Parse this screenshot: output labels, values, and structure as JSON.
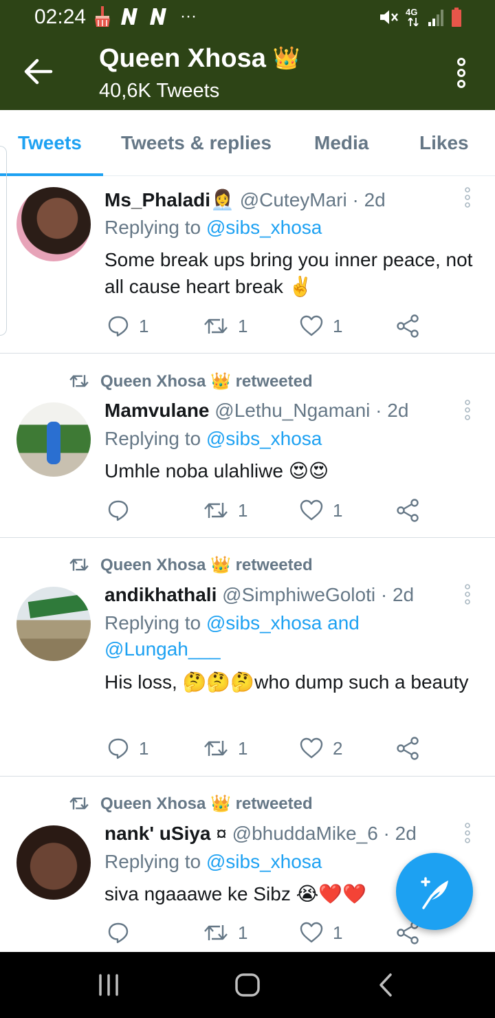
{
  "status_bar": {
    "time": "02:24",
    "left_icons": [
      "broom-icon",
      "n-icon",
      "n-icon",
      "more-dots-icon"
    ],
    "dots": "···",
    "network": "4G",
    "right_icons": [
      "mute-icon",
      "network-4g-icon",
      "signal-icon",
      "battery-icon"
    ]
  },
  "header": {
    "title": "Queen Xhosa",
    "title_emoji": "👑",
    "subtitle": "40,6K Tweets",
    "background": "#2d4416"
  },
  "tabs": [
    {
      "label": "Tweets",
      "active": true
    },
    {
      "label": "Tweets & replies",
      "active": false
    },
    {
      "label": "Media",
      "active": false
    },
    {
      "label": "Likes",
      "active": false
    }
  ],
  "colors": {
    "accent": "#1da1f2",
    "muted": "#657786",
    "text": "#14171a"
  },
  "tweets": [
    {
      "retweeted_by": "",
      "name": "Ms_Phaladi",
      "name_emoji": "👩‍💼",
      "handle": "@CuteyMari · 2d",
      "replying_prefix": "Replying to",
      "replying_to": "@sibs_xhosa",
      "replying_extra": "",
      "text": "Some break ups bring you inner peace, not all cause heart break ✌️",
      "replies": "1",
      "retweets": "1",
      "likes": "1"
    },
    {
      "retweeted_by": "Queen Xhosa 👑 retweeted",
      "name": "Mamvulane",
      "name_emoji": "",
      "handle": "@Lethu_Ngamani · 2d",
      "replying_prefix": "Replying to",
      "replying_to": "@sibs_xhosa",
      "replying_extra": "",
      "text": "Umhle noba ulahliwe 😍😍",
      "replies": "",
      "retweets": "1",
      "likes": "1"
    },
    {
      "retweeted_by": "Queen Xhosa 👑 retweeted",
      "name": "andikhathali",
      "name_emoji": "",
      "handle": "@SimphiweGoloti · 2d",
      "replying_prefix": "Replying to",
      "replying_to": "@sibs_xhosa and",
      "replying_extra": "@Lungah___",
      "text": "His loss, 🤔🤔🤔who dump such a beauty",
      "replies": "1",
      "retweets": "1",
      "likes": "2"
    },
    {
      "retweeted_by": "Queen Xhosa 👑 retweeted",
      "name": "nank' uSiya",
      "name_emoji": "¤",
      "handle": "@bhuddaMike_6 · 2d",
      "replying_prefix": "Replying to",
      "replying_to": "@sibs_xhosa",
      "replying_extra": "",
      "text": "siva ngaaawe ke Sibz 😭❤️❤️",
      "replies": "",
      "retweets": "1",
      "likes": "1"
    }
  ],
  "fab": {
    "icon": "compose-tweet-icon"
  },
  "nav": {
    "icons": [
      "recent-apps-icon",
      "home-icon",
      "back-icon"
    ]
  }
}
